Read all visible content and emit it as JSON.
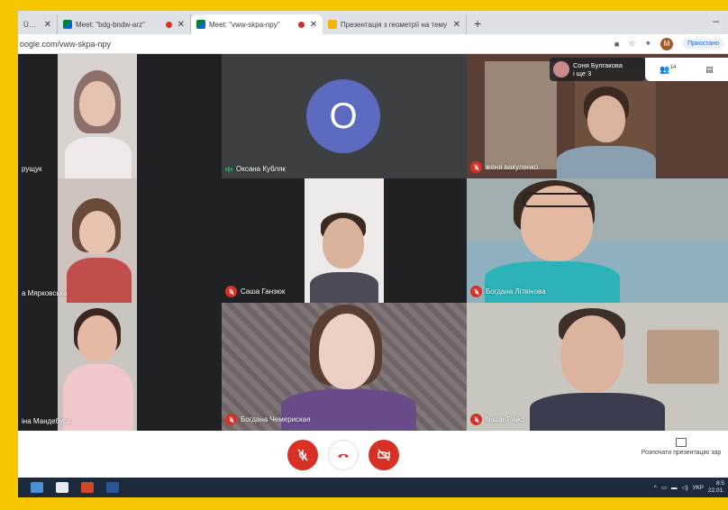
{
  "browser": {
    "tabs": [
      {
        "title": "Ûне:",
        "active": false,
        "icon": "generic",
        "recording": false
      },
      {
        "title": "Meet: \"bdg-bndw-arz\"",
        "active": false,
        "icon": "meet",
        "recording": true
      },
      {
        "title": "Meet: \"vww-skpa-npy\"",
        "active": true,
        "icon": "meet",
        "recording": true
      },
      {
        "title": "Презентація з геометрії на тему",
        "active": false,
        "icon": "slides",
        "recording": false
      }
    ],
    "new_tab": "+",
    "minimize": "–",
    "url": "oogle.com/vww-skpa-npy",
    "pause_label": "Приостано",
    "profile_initial": "M"
  },
  "meet": {
    "top_chip": {
      "name": "Соня Булгакова",
      "sub": "і ще 3"
    },
    "people_count": "14",
    "tiles": [
      {
        "name": "рущук",
        "muted": false,
        "talking": false
      },
      {
        "name": "Оксана Кубляк",
        "muted": false,
        "talking": true,
        "avatar_letter": "O"
      },
      {
        "name": "женя вакуленко",
        "muted": true,
        "talking": false
      },
      {
        "name": "а Мярковська",
        "muted": false,
        "talking": false
      },
      {
        "name": "Саша Ганзюк",
        "muted": true,
        "talking": false
      },
      {
        "name": "Богдана Літвінова",
        "muted": true,
        "talking": false
      },
      {
        "name": "іна Мандебура",
        "muted": false,
        "talking": false
      },
      {
        "name": "Богдана Чемериская",
        "muted": true,
        "talking": false
      },
      {
        "name": "Nazar Paiko",
        "muted": true,
        "talking": false
      }
    ],
    "present_label": "Розпочати презентацію зар"
  },
  "taskbar": {
    "lang": "УКР",
    "time": "8:5",
    "date": "22.01."
  },
  "colors": {
    "frame": "#f6c600",
    "meet_red": "#d93025",
    "avatar_purple": "#5c6bc0"
  }
}
